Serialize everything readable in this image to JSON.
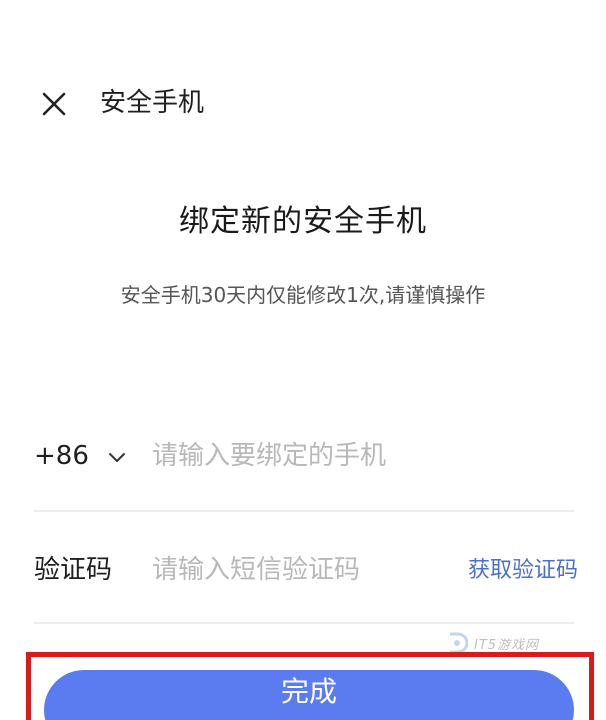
{
  "header": {
    "title": "安全手机",
    "close_icon": "close-icon"
  },
  "main": {
    "title": "绑定新的安全手机",
    "subtitle": "安全手机30天内仅能修改1次,请谨慎操作"
  },
  "phone": {
    "country_code": "+86",
    "dropdown_icon": "chevron-down-icon",
    "placeholder": "请输入要绑定的手机",
    "value": ""
  },
  "verification": {
    "label": "验证码",
    "placeholder": "请输入短信验证码",
    "value": "",
    "get_code_label": "获取验证码"
  },
  "watermark": {
    "text": "IT5游戏网",
    "icon": "it5-logo-icon"
  },
  "actions": {
    "done_label": "完成"
  },
  "colors": {
    "primary_button": "#5b7cf0",
    "link": "#4a6fd1",
    "highlight_border": "#d81c1c"
  }
}
